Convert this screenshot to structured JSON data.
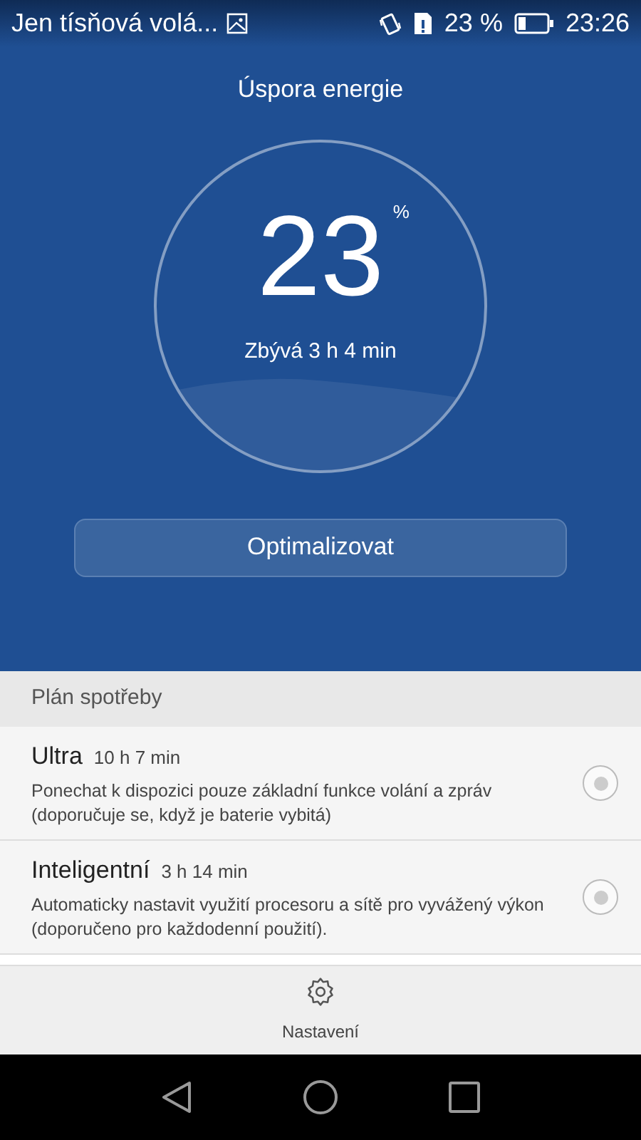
{
  "status_bar": {
    "carrier": "Jen tísňová volá...",
    "battery_text": "23 %",
    "time": "23:26"
  },
  "header": {
    "title": "Úspora energie"
  },
  "gauge": {
    "percent": "23",
    "unit": "%",
    "remaining": "Zbývá 3 h 4 min"
  },
  "optimize_button": "Optimalizovat",
  "plan": {
    "heading": "Plán spotřeby",
    "items": [
      {
        "name": "Ultra",
        "duration": "10 h 7 min",
        "description": "Ponechat k dispozici pouze základní funkce volání a zpráv (doporučuje se, když je baterie vybitá)",
        "selected": false
      },
      {
        "name": "Inteligentní",
        "duration": "3 h 14 min",
        "description": "Automaticky nastavit využití procesoru a sítě pro vyvážený výkon (doporučeno pro každodenní použití).",
        "selected": false
      }
    ]
  },
  "bottom_action": {
    "label": "Nastavení"
  }
}
